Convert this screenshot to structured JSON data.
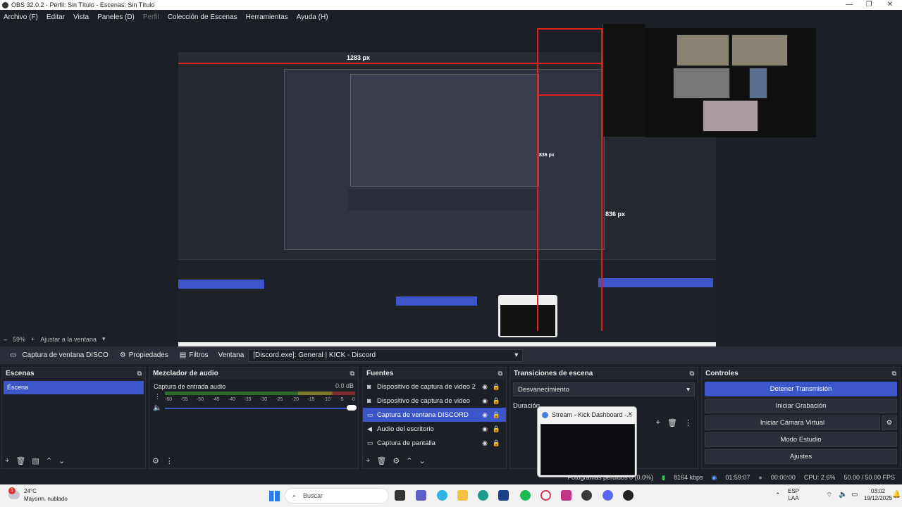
{
  "window": {
    "title": "OBS 32.0.2 - Perfil: Sin Título - Escenas: Sin Título"
  },
  "menu": [
    "Archivo (F)",
    "Editar",
    "Vista",
    "Paneles (D)",
    "Perfil",
    "Colección de Escenas",
    "Herramientas",
    "Ayuda (H)"
  ],
  "preview": {
    "measure_a": "1283 px",
    "measure_b": "836 px",
    "measure_c": "836 px"
  },
  "zoom": {
    "minus": "–",
    "level": "59%",
    "plus": "+",
    "fit": "Ajustar a la ventana"
  },
  "toolbar": {
    "source_name": "Captura de ventana DISCO",
    "properties": "Propiedades",
    "filters": "Filtros",
    "window_label": "Ventana",
    "window_value": "[Discord.exe]: General | KICK - Discord"
  },
  "scenes": {
    "title": "Escenas",
    "items": [
      "Escena"
    ]
  },
  "mixer": {
    "title": "Mezclador de audio",
    "channel": "Captura de entrada audio",
    "level": "0.0 dB",
    "ticks": [
      "-60",
      "-55",
      "-50",
      "-45",
      "-40",
      "-35",
      "-30",
      "-25",
      "-20",
      "-15",
      "-10",
      "-5",
      "0"
    ]
  },
  "sources": {
    "title": "Fuentes",
    "items": [
      {
        "icon": "camera",
        "label": "Dispositivo de captura de video 2"
      },
      {
        "icon": "camera",
        "label": "Dispositivo de captura de video"
      },
      {
        "icon": "window",
        "label": "Captura de ventana DISCORD"
      },
      {
        "icon": "speaker",
        "label": "Audio del escritorio"
      },
      {
        "icon": "monitor",
        "label": "Captura de pantalla"
      }
    ]
  },
  "transitions": {
    "title": "Transiciones de escena",
    "type": "Desvanecimiento",
    "duration_label": "Duración"
  },
  "controls": {
    "title": "Controles",
    "buttons": [
      "Detener Transmisión",
      "Iniciar Grabación",
      "Iniciar Cámara Virtual",
      "Modo Estudio",
      "Ajustes"
    ]
  },
  "status": {
    "frames": "Fotogramas perdidos 0 (0.0%)",
    "bitrate": "8164 kbps",
    "live_time": "01:59:07",
    "rec_time": "00:00:00",
    "cpu": "CPU: 2.6%",
    "fps": "50.00 / 50.00 FPS"
  },
  "taskbar": {
    "weather_temp": "24°C",
    "weather_desc": "Mayorm. nublado",
    "notification_count": "1",
    "search_placeholder": "Buscar",
    "lang": "ESP",
    "lang2": "LAA",
    "time": "03:02",
    "date": "19/12/2025"
  },
  "thumbnail": {
    "title": "Stream - Kick Dashboard -..."
  },
  "colors": {
    "accent": "#3c55c8",
    "bg": "#1d1f26",
    "panel": "#2b2e38",
    "red_guides": "#e02020"
  }
}
